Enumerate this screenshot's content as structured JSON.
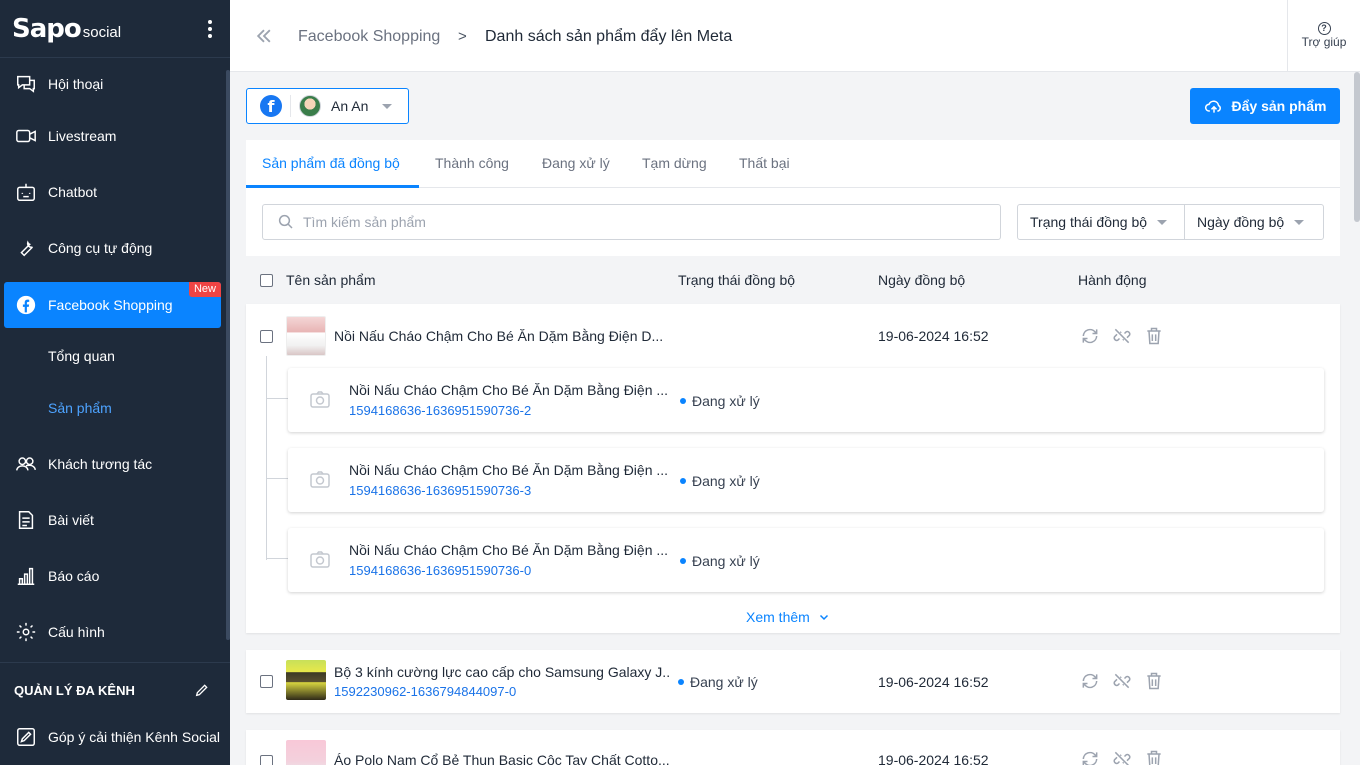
{
  "sidebar": {
    "logo_main": "Sapo",
    "logo_sub": "social",
    "items": [
      {
        "label": "Hội thoại",
        "icon": "chat-icon"
      },
      {
        "label": "Livestream",
        "icon": "video-icon"
      },
      {
        "label": "Chatbot",
        "icon": "bot-icon"
      },
      {
        "label": "Công cụ tự động",
        "icon": "wrench-icon"
      },
      {
        "label": "Facebook Shopping",
        "icon": "facebook-icon",
        "badge": "New"
      },
      {
        "label": "Khách tương tác",
        "icon": "users-icon"
      },
      {
        "label": "Bài viết",
        "icon": "document-icon"
      },
      {
        "label": "Báo cáo",
        "icon": "chart-icon"
      },
      {
        "label": "Cấu hình",
        "icon": "gear-icon"
      }
    ],
    "sub_items": [
      "Tổng quan",
      "Sản phẩm"
    ],
    "section_title": "QUẢN LÝ ĐA KÊNH",
    "feedback": "Góp ý cải thiện Kênh Social"
  },
  "topbar": {
    "breadcrumb_parent": "Facebook Shopping",
    "breadcrumb_sep": ">",
    "breadcrumb_current": "Danh sách sản phẩm đẩy lên Meta",
    "help": "Trợ giúp"
  },
  "account": {
    "name": "An An"
  },
  "push_button": "Đẩy sản phẩm",
  "tabs": [
    "Sản phẩm đã đồng bộ",
    "Thành công",
    "Đang xử lý",
    "Tạm dừng",
    "Thất bại"
  ],
  "search": {
    "placeholder": "Tìm kiếm sản phẩm"
  },
  "filters": {
    "status": "Trạng thái đồng bộ",
    "date": "Ngày đồng bộ"
  },
  "columns": {
    "name": "Tên sản phẩm",
    "status": "Trạng thái đồng bộ",
    "date": "Ngày đồng bộ",
    "action": "Hành động"
  },
  "products": [
    {
      "name": "Nồi Nấu Cháo Chậm Cho Bé Ăn Dặm Bằng Điện D...",
      "date": "19-06-2024 16:52",
      "variants": [
        {
          "name": "Nồi Nấu Cháo Chậm Cho Bé Ăn Dặm Bằng Điện ...",
          "sku": "1594168636-1636951590736-2",
          "status": "Đang xử lý"
        },
        {
          "name": "Nồi Nấu Cháo Chậm Cho Bé Ăn Dặm Bằng Điện ...",
          "sku": "1594168636-1636951590736-3",
          "status": "Đang xử lý"
        },
        {
          "name": "Nồi Nấu Cháo Chậm Cho Bé Ăn Dặm Bằng Điện ...",
          "sku": "1594168636-1636951590736-0",
          "status": "Đang xử lý"
        }
      ],
      "more": "Xem thêm"
    },
    {
      "name": "Bộ 3 kính cường lực cao cấp cho Samsung Galaxy J...",
      "sku": "1592230962-1636794844097-0",
      "status": "Đang xử lý",
      "date": "19-06-2024 16:52"
    },
    {
      "name": "Áo Polo Nam Cổ Bẻ Thun Basic Cộc Tay Chất Cotto...",
      "date": "19-06-2024 16:52"
    }
  ],
  "colors": {
    "accent": "#0a84ff",
    "sidebar_bg": "#1e2a3a",
    "new_badge": "#ef4444"
  }
}
